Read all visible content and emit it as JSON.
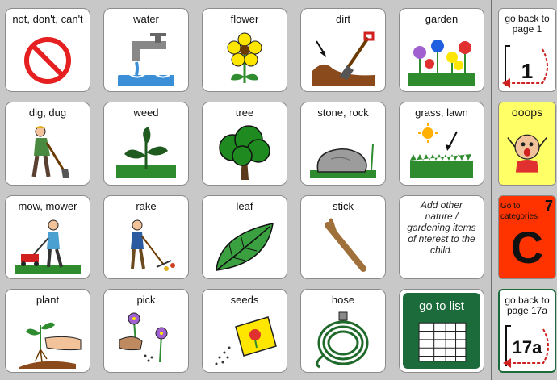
{
  "cells": [
    {
      "label": "not, don't, can't"
    },
    {
      "label": "water"
    },
    {
      "label": "flower"
    },
    {
      "label": "dirt"
    },
    {
      "label": "garden"
    },
    {
      "label": "dig,  dug"
    },
    {
      "label": "weed"
    },
    {
      "label": "tree"
    },
    {
      "label": "stone,  rock"
    },
    {
      "label": "grass,  lawn"
    },
    {
      "label": "mow,  mower"
    },
    {
      "label": "rake"
    },
    {
      "label": "leaf"
    },
    {
      "label": "stick"
    },
    {
      "label": "Add other nature / gardening items of nterest to the child."
    },
    {
      "label": "plant"
    },
    {
      "label": "pick"
    },
    {
      "label": "seeds"
    },
    {
      "label": "hose"
    },
    {
      "label": "go to list"
    }
  ],
  "side": {
    "page1": {
      "label": "go back to page 1",
      "number": "1"
    },
    "ooops": {
      "label": "ooops"
    },
    "categories": {
      "label": "Go to categories",
      "number": "7",
      "letter": "C"
    },
    "page17a": {
      "label": "go back to page 17a",
      "number": "17a"
    }
  },
  "colors": {
    "background": "#c8c8c8",
    "ooops_yellow": "#ffff66",
    "categories_red": "#ff3300",
    "list_green": "#1c6b3a"
  }
}
